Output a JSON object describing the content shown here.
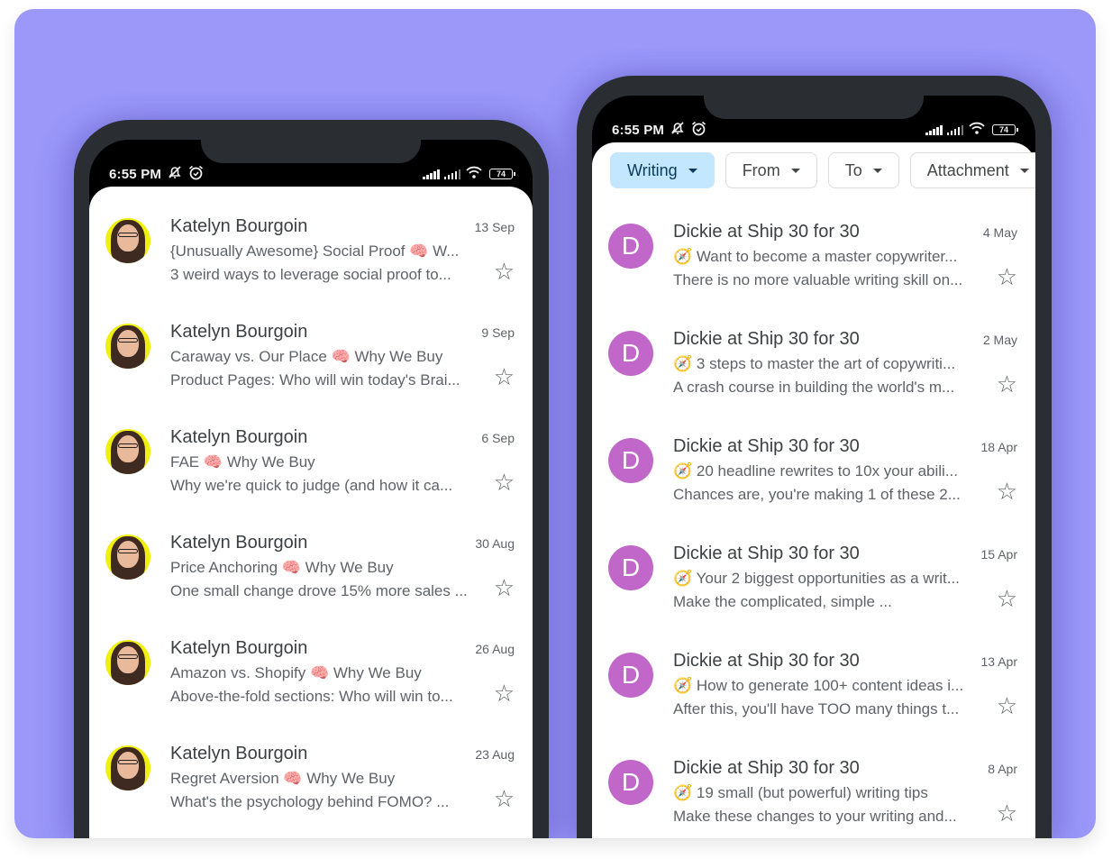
{
  "colors": {
    "background_card": "#9b98fa",
    "phone_frame": "#2a2d31",
    "avatar_letter_bg": "#c067c9",
    "chip_active_bg": "#c2e7ff",
    "text_primary": "#3c4043",
    "text_secondary": "#5f6368"
  },
  "left_phone": {
    "status_bar": {
      "time": "6:55 PM",
      "icons": [
        "bell-off-icon",
        "alarm-icon",
        "signal-icon",
        "signal-icon",
        "wifi-icon",
        "battery-icon"
      ],
      "battery": "74"
    },
    "emails": [
      {
        "avatar": "photo",
        "sender": "Katelyn Bourgoin",
        "date": "13 Sep",
        "subject": "{Unusually Awesome} Social Proof 🧠 W...",
        "snippet": "3 weird ways to leverage social proof to...",
        "starred": false
      },
      {
        "avatar": "photo",
        "sender": "Katelyn Bourgoin",
        "date": "9 Sep",
        "subject": "Caraway vs. Our Place 🧠 Why We Buy",
        "snippet": "Product Pages: Who will win today's Brai...",
        "starred": false
      },
      {
        "avatar": "photo",
        "sender": "Katelyn Bourgoin",
        "date": "6 Sep",
        "subject": "FAE 🧠 Why We Buy",
        "snippet": "Why we're quick to judge (and how it ca...",
        "starred": false
      },
      {
        "avatar": "photo",
        "sender": "Katelyn Bourgoin",
        "date": "30 Aug",
        "subject": "Price Anchoring 🧠 Why We Buy",
        "snippet": "One small change drove 15% more sales ...",
        "starred": false
      },
      {
        "avatar": "photo",
        "sender": "Katelyn Bourgoin",
        "date": "26 Aug",
        "subject": "Amazon vs. Shopify 🧠 Why We Buy",
        "snippet": "Above-the-fold sections: Who will win to...",
        "starred": false
      },
      {
        "avatar": "photo",
        "sender": "Katelyn Bourgoin",
        "date": "23 Aug",
        "subject": "Regret Aversion 🧠 Why We Buy",
        "snippet": "What's the psychology behind FOMO?   ...",
        "starred": false
      }
    ]
  },
  "right_phone": {
    "status_bar": {
      "time": "6:55 PM",
      "icons": [
        "bell-off-icon",
        "alarm-icon",
        "signal-icon",
        "signal-icon",
        "wifi-icon",
        "battery-icon"
      ],
      "battery": "74"
    },
    "filter_chips": [
      {
        "label": "Writing",
        "active": true
      },
      {
        "label": "From",
        "active": false
      },
      {
        "label": "To",
        "active": false
      },
      {
        "label": "Attachment",
        "active": false
      }
    ],
    "emails": [
      {
        "avatar_letter": "D",
        "sender": "Dickie at Ship 30 for 30",
        "date": "4 May",
        "subject": "🧭 Want to become a master copywriter...",
        "snippet": "There is no more valuable writing skill on...",
        "starred": false
      },
      {
        "avatar_letter": "D",
        "sender": "Dickie at Ship 30 for 30",
        "date": "2 May",
        "subject": "🧭 3 steps to master the art of copywriti...",
        "snippet": "A crash course in building the world's m...",
        "starred": false
      },
      {
        "avatar_letter": "D",
        "sender": "Dickie at Ship 30 for 30",
        "date": "18 Apr",
        "subject": "🧭 20 headline rewrites to 10x your abili...",
        "snippet": "Chances are, you're making 1 of these 2...",
        "starred": false
      },
      {
        "avatar_letter": "D",
        "sender": "Dickie at Ship 30 for 30",
        "date": "15 Apr",
        "subject": "🧭 Your 2 biggest opportunities as a writ...",
        "snippet": "Make the complicated, simple             ...",
        "starred": false
      },
      {
        "avatar_letter": "D",
        "sender": "Dickie at Ship 30 for 30",
        "date": "13 Apr",
        "subject": "🧭 How to generate 100+ content ideas i...",
        "snippet": "After this, you'll have TOO many things t...",
        "starred": false
      },
      {
        "avatar_letter": "D",
        "sender": "Dickie at Ship 30 for 30",
        "date": "8 Apr",
        "subject": "🧭 19 small (but powerful) writing tips",
        "snippet": "Make these changes to your writing and...",
        "starred": false
      }
    ]
  }
}
